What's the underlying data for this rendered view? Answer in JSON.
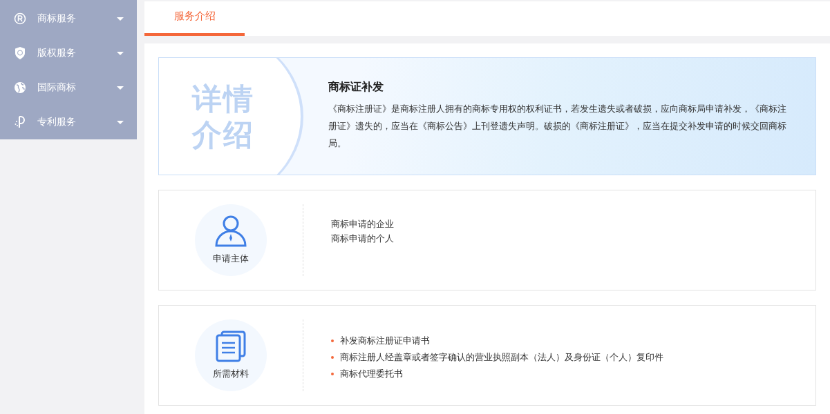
{
  "sidebar": {
    "items": [
      {
        "label": "商标服务"
      },
      {
        "label": "版权服务"
      },
      {
        "label": "国际商标"
      },
      {
        "label": "专利服务"
      }
    ]
  },
  "tabs": [
    {
      "label": "服务介绍",
      "selected": true
    }
  ],
  "intro": {
    "badge_lines": [
      "详情",
      "介绍"
    ],
    "title": "商标证补发",
    "text": "《商标注册证》是商标注册人拥有的商标专用权的权利证书，若发生遗失或者破损，应向商标局申请补发，《商标注册证》遗失的，应当在《商标公告》上刊登遗失声明。破损的《商标注册证》，应当在提交补发申请的时候交回商标局。"
  },
  "sections": [
    {
      "label": "申请主体",
      "kind": "plain",
      "lines": [
        "商标申请的企业",
        "商标申请的个人"
      ]
    },
    {
      "label": "所需材料",
      "kind": "bulleted",
      "lines": [
        "补发商标注册证申请书",
        "商标注册人经盖章或者签字确认的营业执照副本（法人）及身份证（个人）复印件",
        "商标代理委托书"
      ]
    }
  ]
}
